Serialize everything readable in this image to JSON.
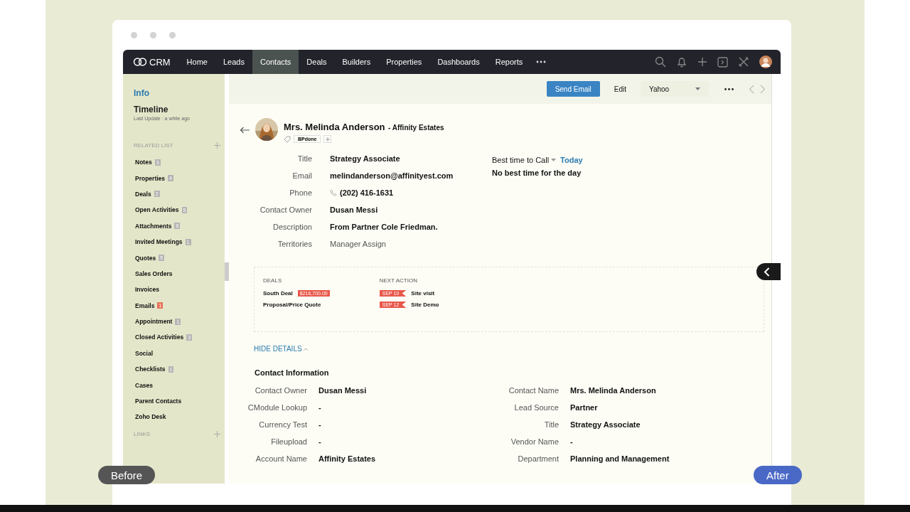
{
  "nav": {
    "logo": "CRM",
    "tabs": [
      {
        "label": "Home",
        "selected": false
      },
      {
        "label": "Leads",
        "selected": false
      },
      {
        "label": "Contacts",
        "selected": true
      },
      {
        "label": "Deals",
        "selected": false
      },
      {
        "label": "Builders",
        "selected": false
      },
      {
        "label": "Properties",
        "selected": false
      },
      {
        "label": "Dashboards",
        "selected": false
      },
      {
        "label": "Reports",
        "selected": false
      }
    ]
  },
  "toolbar": {
    "buttons": [
      {
        "label": "Send Email",
        "kind": "primary"
      },
      {
        "label": "Edit",
        "kind": "plain"
      },
      {
        "label": "Yahoo",
        "kind": "dropdown"
      }
    ]
  },
  "sidebar": {
    "sections": [
      {
        "label": "Info",
        "selected": true
      },
      {
        "label": "Timeline",
        "selected": false,
        "note": "Last Update : a while ago"
      }
    ],
    "related_list": {
      "title": "RELATED LIST",
      "items": [
        {
          "label": "Notes",
          "count": "3",
          "color": "#b5b5b5"
        },
        {
          "label": "Properties",
          "count": "4",
          "color": "#b5b5b5"
        },
        {
          "label": "Deals",
          "count": "2",
          "color": "#b5b5b5"
        },
        {
          "label": "Open Activities",
          "count": "5",
          "color": "#b5b5b5"
        },
        {
          "label": "Attachments",
          "count": "6",
          "color": "#b5b5b5"
        },
        {
          "label": "Invited Meetings",
          "count": "1",
          "color": "#b5b5b5"
        },
        {
          "label": "Quotes",
          "count": "5",
          "color": "#b5b5b5"
        },
        {
          "label": "Sales Orders"
        },
        {
          "label": "Invoices"
        },
        {
          "label": "Emails",
          "count": "1",
          "color": "#e8735a"
        },
        {
          "label": "Appointment",
          "count": "1",
          "color": "#b5b5b5"
        },
        {
          "label": "Closed Activities",
          "count": "3",
          "color": "#b5b5b5"
        },
        {
          "label": "Social"
        },
        {
          "label": "Checklists",
          "count": "1",
          "color": "#b5b5b5"
        },
        {
          "label": "Cases"
        },
        {
          "label": "Parent Contacts"
        },
        {
          "label": "Zoho Desk"
        }
      ]
    },
    "links": {
      "title": "LINKS"
    }
  },
  "record": {
    "name": "Mrs. Melinda Anderson",
    "company": "- Affinity Estates",
    "tags": [
      "BPdone"
    ],
    "fields": [
      {
        "label": "Title",
        "value": "Strategy Associate",
        "kind": "text"
      },
      {
        "label": "Email",
        "value": "melindanderson@affinityest.com",
        "kind": "text"
      },
      {
        "label": "Phone",
        "value": "(202) 416-1631",
        "kind": "phone"
      },
      {
        "label": "Contact Owner",
        "value": "Dusan Messi",
        "kind": "text"
      },
      {
        "label": "Description",
        "value": "From Partner Cole Friedman.",
        "kind": "text"
      },
      {
        "label": "Territories",
        "value": "Manager Assign",
        "kind": "muted"
      }
    ],
    "best_time": {
      "label": "Best time to Call",
      "link": "Today",
      "note": "No best time for the day"
    }
  },
  "summary": {
    "deals": {
      "title": "DEALS",
      "items": [
        {
          "name": "South Deal",
          "amount": "$216,700.00"
        },
        {
          "name": "Proposal/Price Quote"
        }
      ]
    },
    "next_action": {
      "title": "NEXT ACTION",
      "items": [
        {
          "date": "SEP 10",
          "label": "Site visit"
        },
        {
          "date": "SEP 12",
          "label": "Site Demo"
        }
      ]
    }
  },
  "hide_details": "HIDE DETAILS",
  "contact_information": {
    "title": "Contact Information",
    "left": [
      {
        "label": "Contact Owner",
        "value": "Dusan Messi"
      },
      {
        "label": "CModule Lookup",
        "value": "-"
      },
      {
        "label": "Currency Test",
        "value": "-"
      },
      {
        "label": "Fileupload",
        "value": "-"
      },
      {
        "label": "Account Name",
        "value": "Affinity Estates"
      }
    ],
    "right": [
      {
        "label": "Contact Name",
        "value": "Mrs. Melinda Anderson"
      },
      {
        "label": "Lead Source",
        "value": "Partner"
      },
      {
        "label": "Title",
        "value": "Strategy Associate"
      },
      {
        "label": "Vendor Name",
        "value": "-"
      },
      {
        "label": "Department",
        "value": "Planning and Management"
      }
    ]
  },
  "overlay": {
    "before": "Before",
    "after": "After"
  }
}
